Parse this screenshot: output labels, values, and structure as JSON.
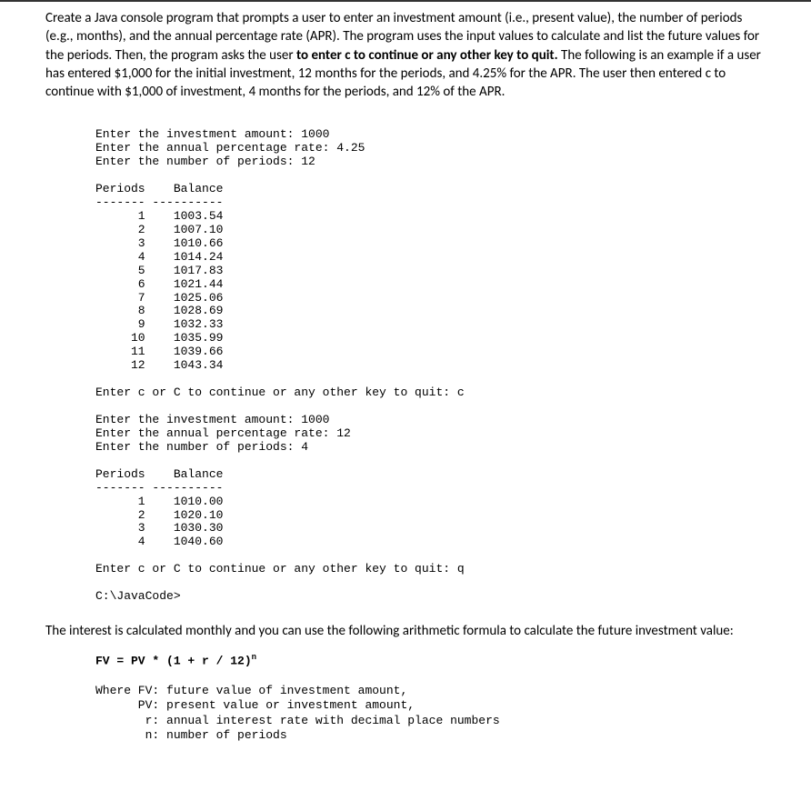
{
  "intro": {
    "p1_a": "Create a Java console program that prompts a user to enter an investment amount (i.e., present value), the number of periods (e.g., months), and the annual percentage rate (APR).  The program uses the input values to calculate and list the future values for the periods.  Then, the program asks the user ",
    "p1_b": "to enter c to continue or any other key to quit.",
    "p1_c": "  The following is an example if a user has entered $1,000 for the initial investment, 12 months for the periods, and 4.25% for the APR.  The user then entered c to continue with $1,000 of investment, 4 months for the periods, and 12% of the APR."
  },
  "console": {
    "prompt_invest": "Enter the investment amount: ",
    "val_invest1": "1000",
    "prompt_apr": "Enter the annual percentage rate: ",
    "val_apr1": "4.25",
    "prompt_periods": "Enter the number of periods: ",
    "val_periods1": "12",
    "header": "Periods    Balance",
    "divider": "------- ----------",
    "rows1": [
      "      1    1003.54",
      "      2    1007.10",
      "      3    1010.66",
      "      4    1014.24",
      "      5    1017.83",
      "      6    1021.44",
      "      7    1025.06",
      "      8    1028.69",
      "      9    1032.33",
      "     10    1035.99",
      "     11    1039.66",
      "     12    1043.34"
    ],
    "continue_prompt": "Enter c or C to continue or any other key to quit: ",
    "continue_val1": "c",
    "val_invest2": "1000",
    "val_apr2": "12",
    "val_periods2": "4",
    "rows2": [
      "      1    1010.00",
      "      2    1020.10",
      "      3    1030.30",
      "      4    1040.60"
    ],
    "continue_val2": "q",
    "cwd": "C:\\JavaCode>"
  },
  "after": "The interest is calculated monthly and you can use the following arithmetic formula to calculate the future investment value:",
  "formula": {
    "line": "FV = PV * (1 + r / 12)",
    "exp": "n",
    "where1": "Where FV: future value of investment amount,",
    "where2": "      PV: present value or investment amount,",
    "where3": "       r: annual interest rate with decimal place numbers",
    "where4": "       n: number of periods"
  }
}
